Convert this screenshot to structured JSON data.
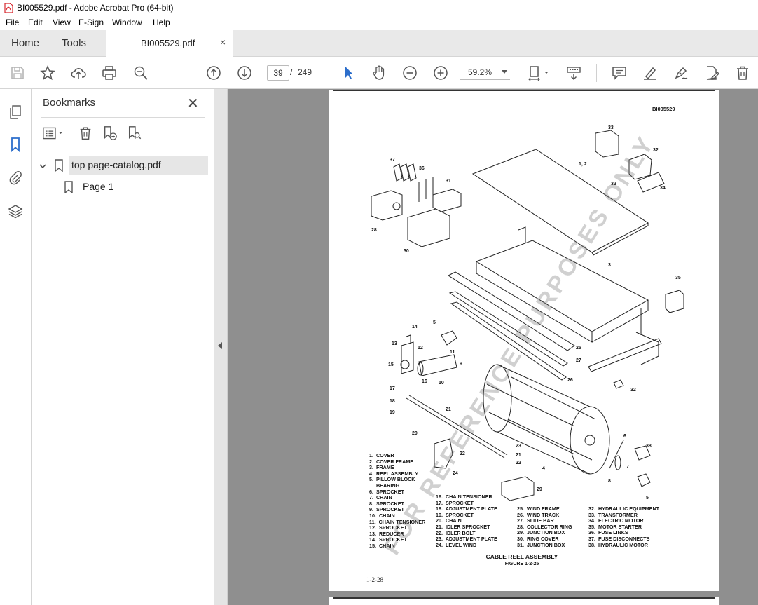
{
  "window": {
    "title": "BI005529.pdf - Adobe Acrobat Pro (64-bit)"
  },
  "menu": [
    "File",
    "Edit",
    "View",
    "E-Sign",
    "Window",
    "Help"
  ],
  "tabs": {
    "home": "Home",
    "tools": "Tools",
    "document": "BI005529.pdf",
    "close_glyph": "×"
  },
  "toolbar": {
    "current_page": "39",
    "page_separator": "/",
    "total_pages": "249",
    "zoom": "59.2%"
  },
  "bookmarks": {
    "title": "Bookmarks",
    "close_glyph": "✕",
    "items": [
      {
        "label": "top page-catalog.pdf",
        "expanded": true
      },
      {
        "label": "Page 1"
      }
    ]
  },
  "document": {
    "doc_id": "BI005529",
    "caption_title": "CABLE REEL ASSEMBLY",
    "caption_figure": "FIGURE 1-2-25",
    "page_number": "1-2-28",
    "watermark": "FOR REFERENCE PURPOSES ONLY",
    "callouts": [
      "33",
      "1, 2",
      "32",
      "37",
      "36",
      "31",
      "32",
      "34",
      "28",
      "30",
      "3",
      "35",
      "5",
      "14",
      "13",
      "12",
      "11",
      "9",
      "15",
      "16",
      "10",
      "25",
      "27",
      "17",
      "26",
      "32",
      "18",
      "19",
      "21",
      "20",
      "22",
      "23",
      "21",
      "22",
      "24",
      "4",
      "6",
      "38",
      "7",
      "8",
      "5",
      "29"
    ],
    "legend_col1": "1.  COVER\n2.  COVER FRAME\n3.  FRAME\n4.  REEL ASSEMBLY\n5.  PILLOW BLOCK\n     BEARING\n6.  SPROCKET\n7.  CHAIN\n8.  SPROCKET\n9.  SPROCKET\n10.  CHAIN\n11.  CHAIN TENSIONER\n12.  SPROCKET\n13.  REDUCER\n14.  SPROCKET\n15.  CHAIN",
    "legend_col2": "16.  CHAIN TENSIONER\n17.  SPROCKET\n18.  ADJUSTMENT PLATE\n19.  SPROCKET\n20.  CHAIN\n21.  IDLER SPROCKET\n22.  IDLER BOLT\n23.  ADJUSTMENT PLATE\n24.  LEVEL WIND",
    "legend_col3": "25.  WIND FRAME\n26.  WIND TRACK\n27.  SLIDE BAR\n28.  COLLECTOR RING\n29.  JUNCTION BOX\n30.  RING COVER\n31.  JUNCTION BOX",
    "legend_col4": "32.  HYDRAULIC EQUIPMENT\n33.  TRANSFORMER\n34.  ELECTRIC MOTOR\n35.  MOTOR STARTER\n36.  FUSE LINKS\n37.  FUSE DISCONNECTS\n38.  HYDRAULIC MOTOR"
  },
  "colors": {
    "tab_bar": "#e9e9e9",
    "document_bg": "#8f8f8f",
    "accent": "#2c6ecb",
    "pdf_icon": "#d7282f"
  }
}
